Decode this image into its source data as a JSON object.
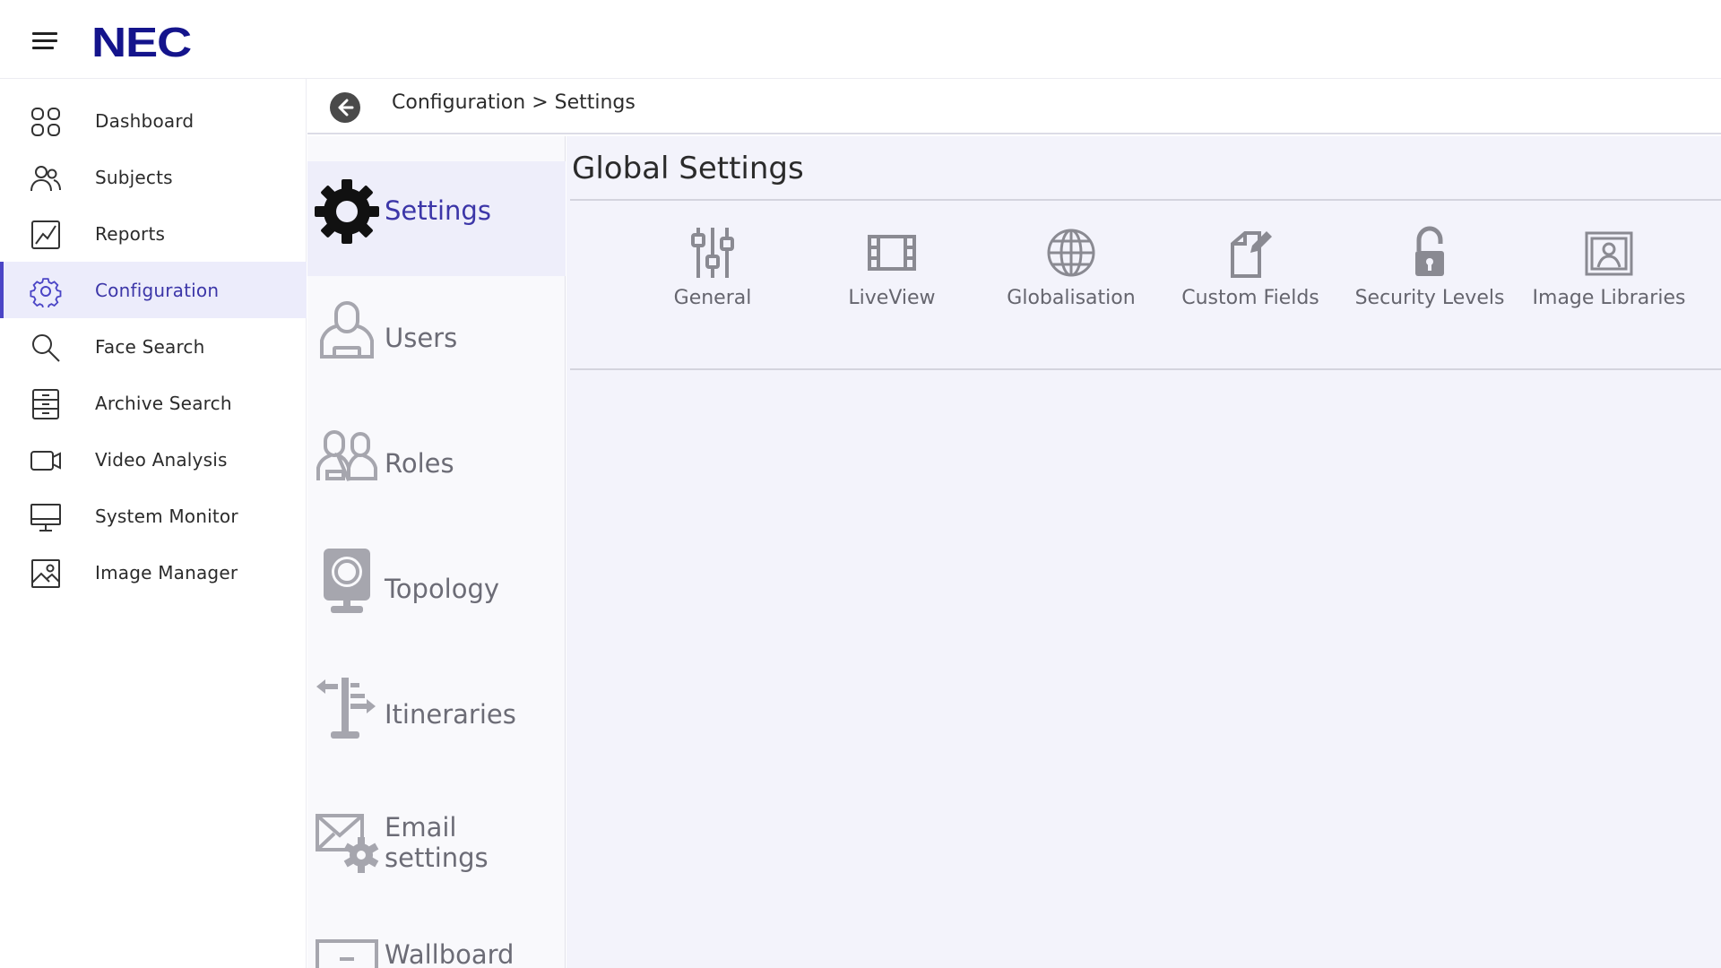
{
  "brand": {
    "logo_text": "NEC",
    "accent": "#14148c",
    "active_accent": "#4b45c6"
  },
  "header": {
    "menu_icon": "hamburger-icon"
  },
  "sidebar": {
    "items": [
      {
        "label": "Dashboard",
        "icon": "grid-icon",
        "active": false
      },
      {
        "label": "Subjects",
        "icon": "people-icon",
        "active": false
      },
      {
        "label": "Reports",
        "icon": "chart-line-icon",
        "active": false
      },
      {
        "label": "Configuration",
        "icon": "gear-icon",
        "active": true
      },
      {
        "label": "Face Search",
        "icon": "search-icon",
        "active": false
      },
      {
        "label": "Archive Search",
        "icon": "archive-icon",
        "active": false
      },
      {
        "label": "Video Analysis",
        "icon": "video-camera-icon",
        "active": false
      },
      {
        "label": "System Monitor",
        "icon": "monitor-icon",
        "active": false
      },
      {
        "label": "Image Manager",
        "icon": "image-icon",
        "active": false
      }
    ]
  },
  "breadcrumb": {
    "text": "Configuration > Settings",
    "back_icon": "arrow-left-icon"
  },
  "categories": {
    "items": [
      {
        "label": "Settings",
        "icon": "cog-icon",
        "active": true
      },
      {
        "label": "Users",
        "icon": "user-icon",
        "active": false
      },
      {
        "label": "Roles",
        "icon": "roles-icon",
        "active": false
      },
      {
        "label": "Topology",
        "icon": "camera-icon",
        "active": false
      },
      {
        "label": "Itineraries",
        "icon": "signpost-icon",
        "active": false
      },
      {
        "label": "Email settings",
        "icon": "email-gear-icon",
        "active": false
      },
      {
        "label": "Wallboard",
        "icon": "wallboard-icon",
        "active": false
      }
    ]
  },
  "main": {
    "title": "Global Settings",
    "tiles": [
      {
        "label": "General",
        "icon": "sliders-icon"
      },
      {
        "label": "LiveView",
        "icon": "film-icon"
      },
      {
        "label": "Globalisation",
        "icon": "globe-icon"
      },
      {
        "label": "Custom Fields",
        "icon": "document-edit-icon"
      },
      {
        "label": "Security Levels",
        "icon": "padlock-icon"
      },
      {
        "label": "Image Libraries",
        "icon": "image-library-icon"
      }
    ]
  }
}
